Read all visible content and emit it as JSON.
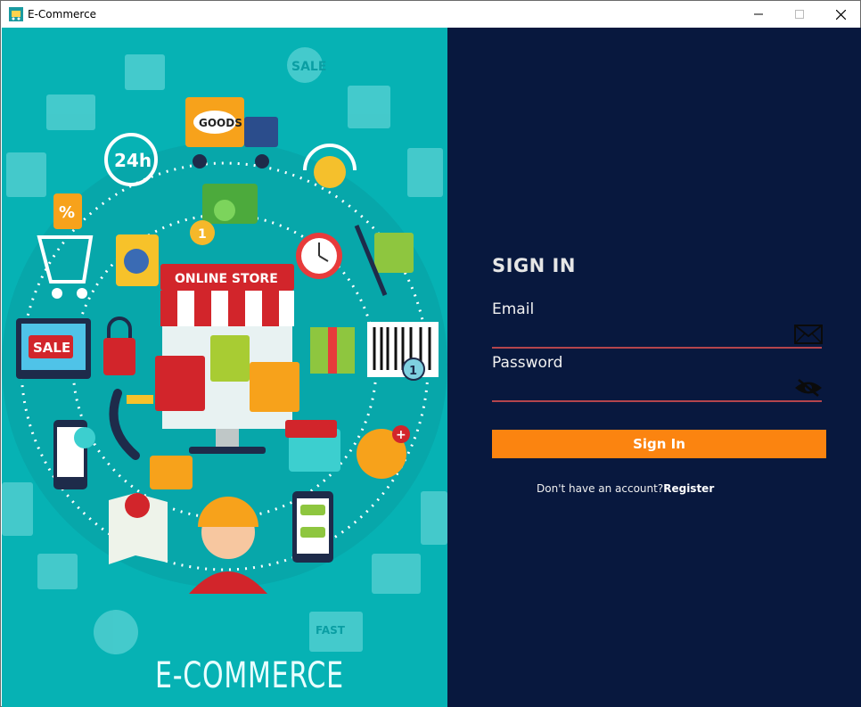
{
  "window": {
    "title": "E-Commerce",
    "controls": {
      "minimize": "minimize",
      "maximize": "maximize",
      "close": "close"
    }
  },
  "left_panel": {
    "banner_text": "E-COMMERCE",
    "illustration": {
      "goods_truck": "GOODS",
      "store_sign": "ONLINE STORE",
      "sale_label": "SALE",
      "sale_tag": "SALE",
      "hours": "24h",
      "percent": "%",
      "coin": "1",
      "barcode_number": "1",
      "fast_truck": "FAST"
    }
  },
  "signin": {
    "heading": "SIGN IN",
    "email_label": "Email",
    "email_value": "",
    "password_label": "Password",
    "password_value": "",
    "button_label": "Sign In",
    "footer_text": "Don't have an account?",
    "register_link": "Register"
  },
  "colors": {
    "left_bg": "#06b2b4",
    "right_bg": "#08183e",
    "accent": "#fb8410",
    "field_line": "#b4454d"
  }
}
